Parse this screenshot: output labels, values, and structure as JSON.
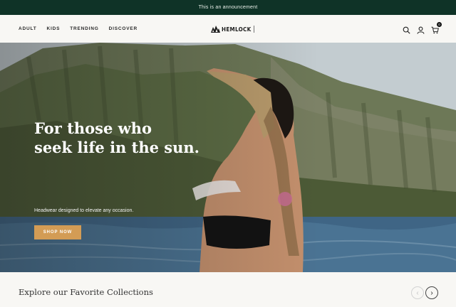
{
  "announcement": "This is an announcement",
  "nav": [
    "ADULT",
    "KIDS",
    "TRENDING",
    "DISCOVER"
  ],
  "logo": "HEMLOCK",
  "icons": [
    "search-icon",
    "account-icon",
    "cart-icon"
  ],
  "cart_count": "0",
  "hero": {
    "title_line1": "For those who",
    "title_line2": "seek life in the sun.",
    "subtitle": "Headwear designed to elevate any occasion.",
    "button": "SHOP NOW"
  },
  "collections": {
    "heading": "Explore our Favorite Collections",
    "prev": "‹",
    "next": "›"
  },
  "colors": {
    "announcement_bg": "#0f3327",
    "button_bg": "#d39c55",
    "page_bg": "#f8f7f4"
  }
}
